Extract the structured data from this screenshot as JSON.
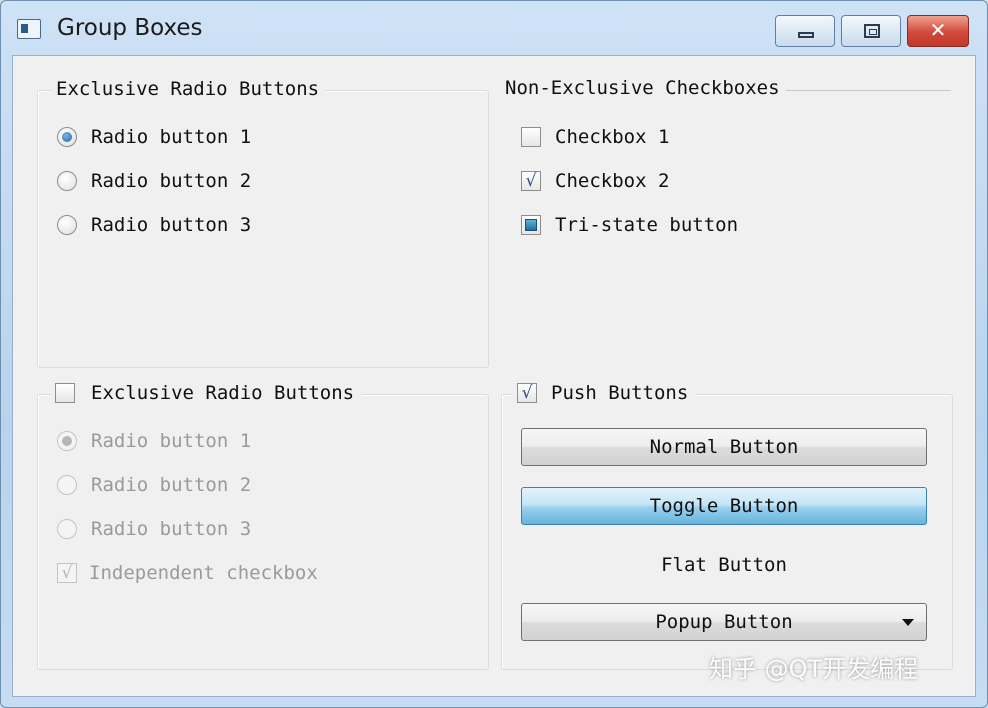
{
  "window": {
    "title": "Group Boxes",
    "close_glyph": "✕"
  },
  "group_exclusive": {
    "title": "Exclusive Radio Buttons",
    "items": [
      {
        "label": "Radio button 1",
        "checked": true
      },
      {
        "label": "Radio button 2",
        "checked": false
      },
      {
        "label": "Radio button 3",
        "checked": false
      }
    ]
  },
  "group_nonexclusive": {
    "title": "Non-Exclusive Checkboxes",
    "items": [
      {
        "label": "Checkbox 1",
        "state": "unchecked"
      },
      {
        "label": "Checkbox 2",
        "state": "checked",
        "mark": "√"
      },
      {
        "label": "Tri-state button",
        "state": "partial"
      }
    ]
  },
  "group_checkable": {
    "title": "Exclusive Radio Buttons",
    "checked": false,
    "items": [
      {
        "label": "Radio button 1",
        "checked": true,
        "enabled": false
      },
      {
        "label": "Radio button 2",
        "checked": false,
        "enabled": false
      },
      {
        "label": "Radio button 3",
        "checked": false,
        "enabled": false
      }
    ],
    "independent_checkbox": {
      "label": "Independent checkbox",
      "checked": true,
      "enabled": false,
      "mark": "√"
    }
  },
  "group_push": {
    "title": "Push Buttons",
    "checked": true,
    "mark": "√",
    "buttons": {
      "normal": "Normal Button",
      "toggle": "Toggle Button",
      "flat": "Flat Button",
      "popup": "Popup Button"
    }
  },
  "watermark": "知乎 @QT开发编程",
  "colors": {
    "title_bar": "#c6dcf3",
    "client_bg": "#f0f0f0",
    "close_button": "#c0392b",
    "toggle_on": "#68b3db"
  }
}
